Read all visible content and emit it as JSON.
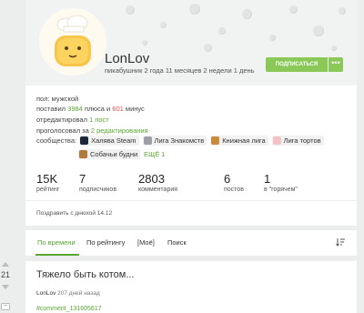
{
  "profile": {
    "username": "LonLov",
    "joined": "пикабушник 2 года 11 месяцев 2 недели 1 день",
    "subscribe_label": "ПОДПИСАТЬСЯ",
    "more_label": "•••",
    "gender_label": "пол:",
    "gender_value": "мужской",
    "ratings_prefix": "поставил",
    "pluses": "3984",
    "pluses_word": "плюса и",
    "minuses": "601",
    "minuses_word": "минус",
    "edited_prefix": "отредактировал",
    "edited_value": "1 пост",
    "voted_prefix": "проголосовал за",
    "voted_value": "2 редактирования",
    "communities_label": "сообщества:",
    "communities": [
      {
        "name": "Халява Steam",
        "color": "#1b2838"
      },
      {
        "name": "Лига Знакомств",
        "color": "#9aa0a6"
      },
      {
        "name": "Книжная лига",
        "color": "#c98a3c"
      },
      {
        "name": "Лига тортов",
        "color": "#f3c2c9"
      },
      {
        "name": "Собачьи будни",
        "color": "#b07a3a"
      }
    ],
    "communities_more": "ЕЩЁ 1",
    "stats": [
      {
        "value": "15K",
        "label": "рейтинг"
      },
      {
        "value": "7",
        "label": "подписчиков"
      },
      {
        "value": "2803",
        "label": "комментария"
      },
      {
        "value": "6",
        "label": "постов"
      },
      {
        "value": "1",
        "label": "в \"горячем\""
      }
    ],
    "birthday": "Поздравить с днюхой 14.12"
  },
  "tabs": [
    {
      "label": "По времени",
      "active": true
    },
    {
      "label": "По рейтингу",
      "active": false
    },
    {
      "label": "[Моё]",
      "active": false
    },
    {
      "label": "Поиск",
      "active": false
    }
  ],
  "sort_icon": "sort-icon",
  "post": {
    "rating": "21",
    "title": "Тяжело быть котом...",
    "author": "LonLov",
    "time": "207 дней назад",
    "tag": "#comment_131605617",
    "collapse_label": "–"
  },
  "colors": {
    "accent": "#8ac858",
    "link_green": "#5aa832",
    "minus_red": "#d9534f",
    "page_bg": "#eceeed"
  }
}
